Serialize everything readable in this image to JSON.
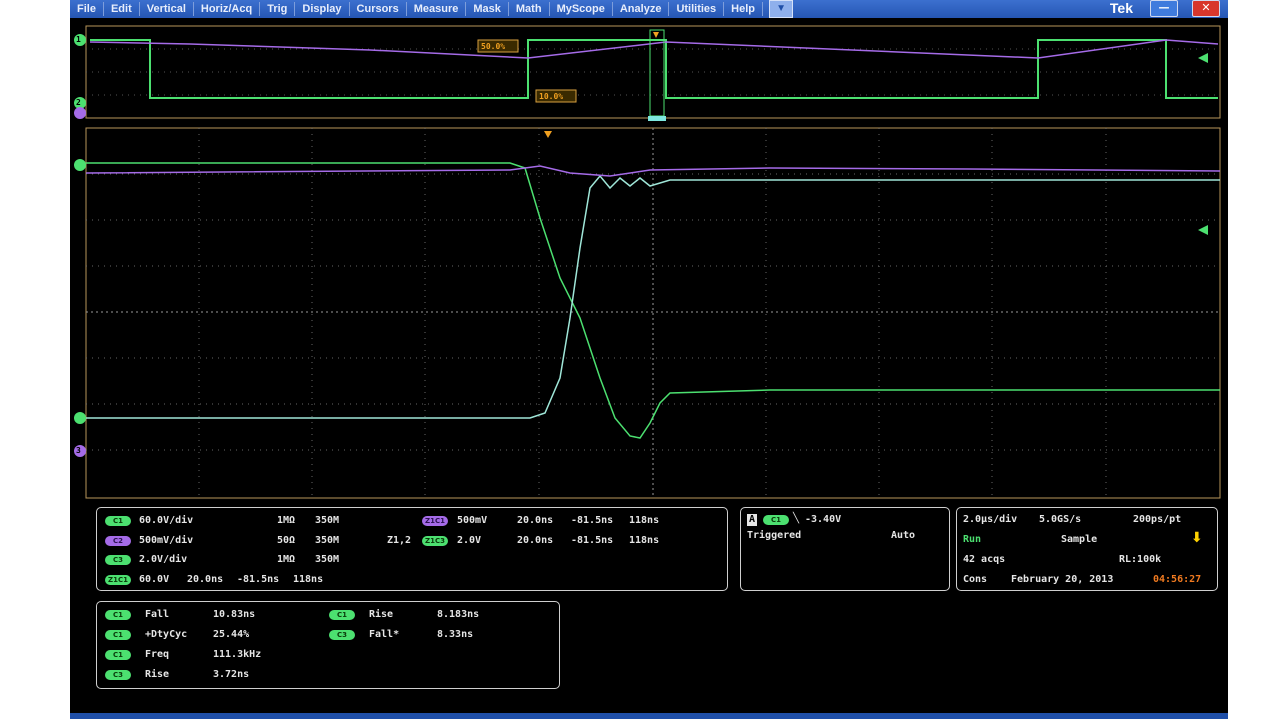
{
  "menu": [
    "File",
    "Edit",
    "Vertical",
    "Horiz/Acq",
    "Trig",
    "Display",
    "Cursors",
    "Measure",
    "Mask",
    "Math",
    "MyScope",
    "Analyze",
    "Utilities",
    "Help"
  ],
  "brand": "Tek",
  "window": {
    "minimize": "—",
    "close": "✕"
  },
  "channels": {
    "c1_label": "1",
    "c2_label": "2",
    "c3_label": "3",
    "zoom_markers": {
      "a": "50.0%",
      "b": "10.0%"
    }
  },
  "vertical": {
    "rows": [
      {
        "chip": "C1",
        "scale": "60.0V/div",
        "imp": "1MΩ",
        "bw": "350M"
      },
      {
        "chip": "C2",
        "scale": "500mV/div",
        "imp": "50Ω",
        "bw": "350M"
      },
      {
        "chip": "C3",
        "scale": "2.0V/div",
        "imp": "1MΩ",
        "bw": "350M"
      }
    ],
    "bw_symbol": "B_W:",
    "z_label": "Z1,2",
    "zoom_rows": [
      {
        "chip": "Z1C1",
        "scale": "500mV",
        "pos": "20.0ns",
        "offset": "-81.5ns",
        "len": "118ns"
      },
      {
        "chip": "Z1C3",
        "scale": "2.0V",
        "pos": "20.0ns",
        "offset": "-81.5ns",
        "len": "118ns"
      },
      {
        "chip": "Z1C1",
        "scale": "60.0V",
        "pos": "20.0ns",
        "offset": "-81.5ns",
        "len": "118ns"
      }
    ]
  },
  "trigger": {
    "chip": "C1",
    "level": "-3.40V",
    "status": "Triggered",
    "mode": "Auto",
    "source": "A"
  },
  "acquisition": {
    "timebase": "2.0µs/div",
    "rate": "5.0GS/s",
    "points": "200ps/pt",
    "state": "Run",
    "mode": "Sample",
    "acqs": "42 acqs",
    "rl": "RL:100k",
    "cons": "Cons",
    "date": "February 20, 2013",
    "time": "04:56:27"
  },
  "measurements": [
    {
      "chip": "C1",
      "name": "Fall",
      "value": "10.83ns"
    },
    {
      "chip": "C1",
      "name": "+DtyCyc",
      "value": "25.44%"
    },
    {
      "chip": "C1",
      "name": "Freq",
      "value": "111.3kHz"
    },
    {
      "chip": "C3",
      "name": "Rise",
      "value": "3.72ns"
    },
    {
      "chip": "C1",
      "name": "Rise",
      "value": "8.183ns"
    },
    {
      "chip": "C3",
      "name": "Fall*",
      "value": "8.33ns"
    }
  ],
  "colors": {
    "ch1": "#4ce070",
    "ch2": "#a56be8",
    "ch3": "#9fe6d8",
    "grid": "#8a8a8a",
    "border": "#b8965a"
  }
}
